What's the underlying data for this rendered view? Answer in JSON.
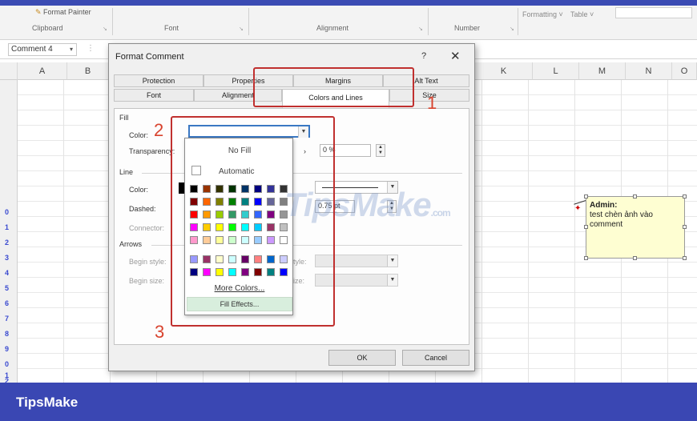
{
  "ribbon": {
    "format_painter": "Format Painter",
    "groups": [
      "Clipboard",
      "Font",
      "Alignment",
      "Number"
    ],
    "formatting": "Formatting",
    "table": "Table"
  },
  "namebox": {
    "value": "Comment 4"
  },
  "columns": [
    "A",
    "B",
    "K",
    "L",
    "M",
    "N",
    "O"
  ],
  "rows": [
    "0",
    "1",
    "2",
    "3",
    "4",
    "5",
    "6",
    "7",
    "8",
    "9",
    "0",
    "1",
    "2"
  ],
  "comment": {
    "author": "Admin:",
    "text": "test chèn ảnh vào comment"
  },
  "dialog": {
    "title": "Format Comment",
    "help": "?",
    "close": "✕",
    "tabs_back": [
      "Protection",
      "Properties",
      "Margins",
      "Alt Text"
    ],
    "tabs_front": [
      "Font",
      "Alignment",
      "Colors and Lines",
      "Size"
    ],
    "fill_section": "Fill",
    "color_label": "Color:",
    "transparency_label": "Transparency:",
    "transparency_value": "0 %",
    "line_section": "Line",
    "line_color_label": "Color:",
    "dashed_label": "Dashed:",
    "weight_value": "0.75 pt",
    "connector_label": "Connector:",
    "arrows_section": "Arrows",
    "begin_style_label": "Begin style:",
    "begin_size_label": "Begin size:",
    "end_style_label": "End style:",
    "end_size_label": "End size:",
    "ok_label": "OK",
    "cancel_label": "Cancel"
  },
  "popup": {
    "no_fill": "No Fill",
    "automatic": "Automatic",
    "more_colors": "More Colors...",
    "fill_effects": "Fill Effects...",
    "swatches_main": [
      "#000000",
      "#993300",
      "#333300",
      "#003300",
      "#003366",
      "#000080",
      "#333399",
      "#333333",
      "#800000",
      "#ff6600",
      "#808000",
      "#008000",
      "#008080",
      "#0000ff",
      "#666699",
      "#808080",
      "#ff0000",
      "#ff9900",
      "#99cc00",
      "#339966",
      "#33cccc",
      "#3366ff",
      "#800080",
      "#969696",
      "#ff00ff",
      "#ffcc00",
      "#ffff00",
      "#00ff00",
      "#00ffff",
      "#00ccff",
      "#993366",
      "#c0c0c0",
      "#ff99cc",
      "#ffcc99",
      "#ffff99",
      "#ccffcc",
      "#ccffff",
      "#99ccff",
      "#cc99ff",
      "#ffffff"
    ],
    "swatches_extra": [
      "#9999ff",
      "#993366",
      "#ffffcc",
      "#ccffff",
      "#660066",
      "#ff8080",
      "#0066cc",
      "#ccccff",
      "#000080",
      "#ff00ff",
      "#ffff00",
      "#00ffff",
      "#800080",
      "#800000",
      "#008080",
      "#0000ff"
    ]
  },
  "annotations": [
    "1",
    "2",
    "3"
  ],
  "watermark": {
    "main": "TipsMake",
    "suffix": ".com"
  },
  "footer": {
    "brand": "TipsMake"
  }
}
